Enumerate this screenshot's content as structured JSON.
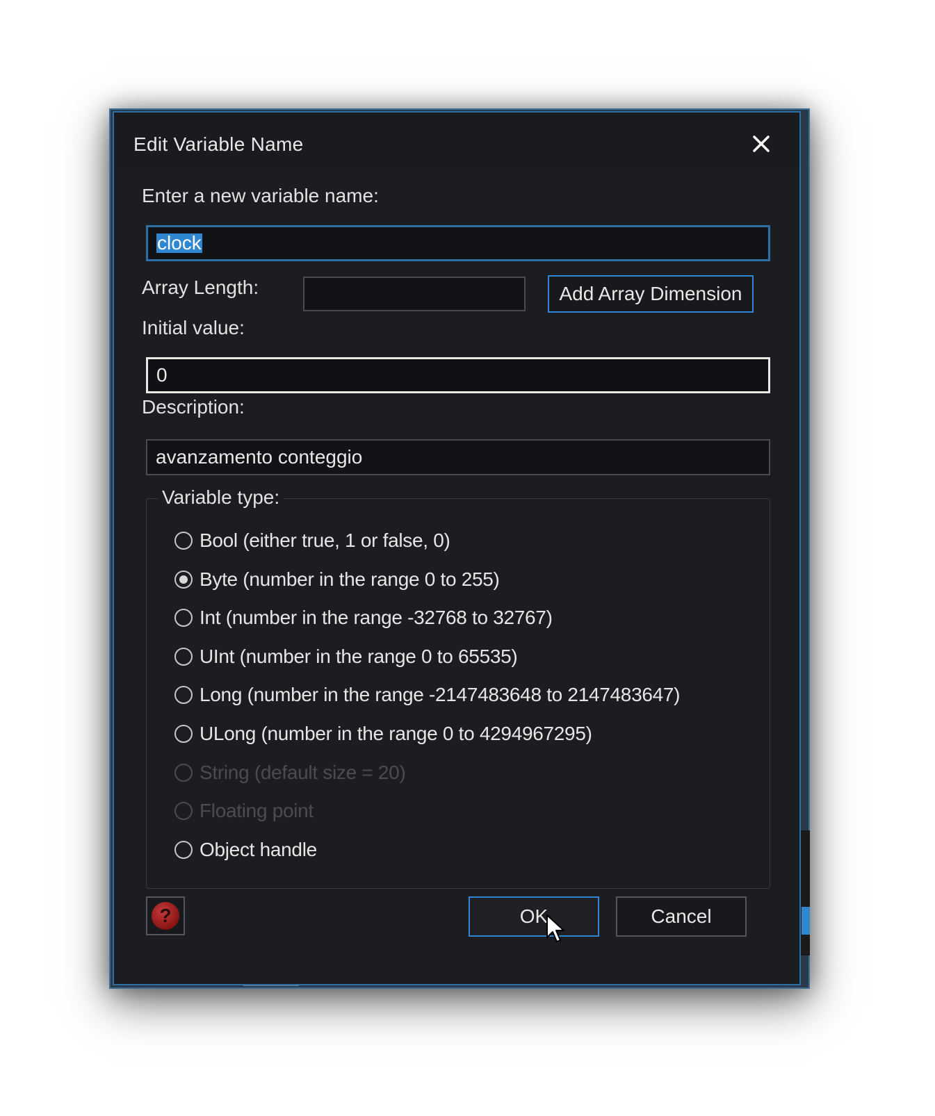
{
  "dialog": {
    "title": "Edit Variable Name",
    "close_icon": "close-icon"
  },
  "form": {
    "name_label": "Enter a new variable name:",
    "name_value": "clock",
    "array_length_label": "Array Length:",
    "array_length_value": "",
    "add_array_dimension_label": "Add Array Dimension",
    "initial_value_label": "Initial value:",
    "initial_value": "0",
    "description_label": "Description:",
    "description_value": "avanzamento conteggio"
  },
  "variable_type": {
    "legend": "Variable type:",
    "options": [
      {
        "label": "Bool (either true, 1 or false, 0)",
        "checked": false,
        "disabled": false
      },
      {
        "label": "Byte (number in the range 0 to 255)",
        "checked": true,
        "disabled": false
      },
      {
        "label": "Int (number in the range -32768 to 32767)",
        "checked": false,
        "disabled": false
      },
      {
        "label": "UInt (number in the range 0 to 65535)",
        "checked": false,
        "disabled": false
      },
      {
        "label": "Long (number in the range -2147483648 to 2147483647)",
        "checked": false,
        "disabled": false
      },
      {
        "label": "ULong (number in the range 0 to 4294967295)",
        "checked": false,
        "disabled": false
      },
      {
        "label": "String (default size = 20)",
        "checked": false,
        "disabled": true
      },
      {
        "label": "Floating point",
        "checked": false,
        "disabled": true
      },
      {
        "label": "Object handle",
        "checked": false,
        "disabled": false
      }
    ]
  },
  "buttons": {
    "help_icon": "help-icon",
    "help_glyph": "?",
    "ok_label": "OK",
    "cancel_label": "Cancel"
  },
  "colors": {
    "dialog_bg": "#1c1d21",
    "accent": "#2e86d4",
    "selection": "#2f86d1",
    "help_red": "#8a1414"
  }
}
